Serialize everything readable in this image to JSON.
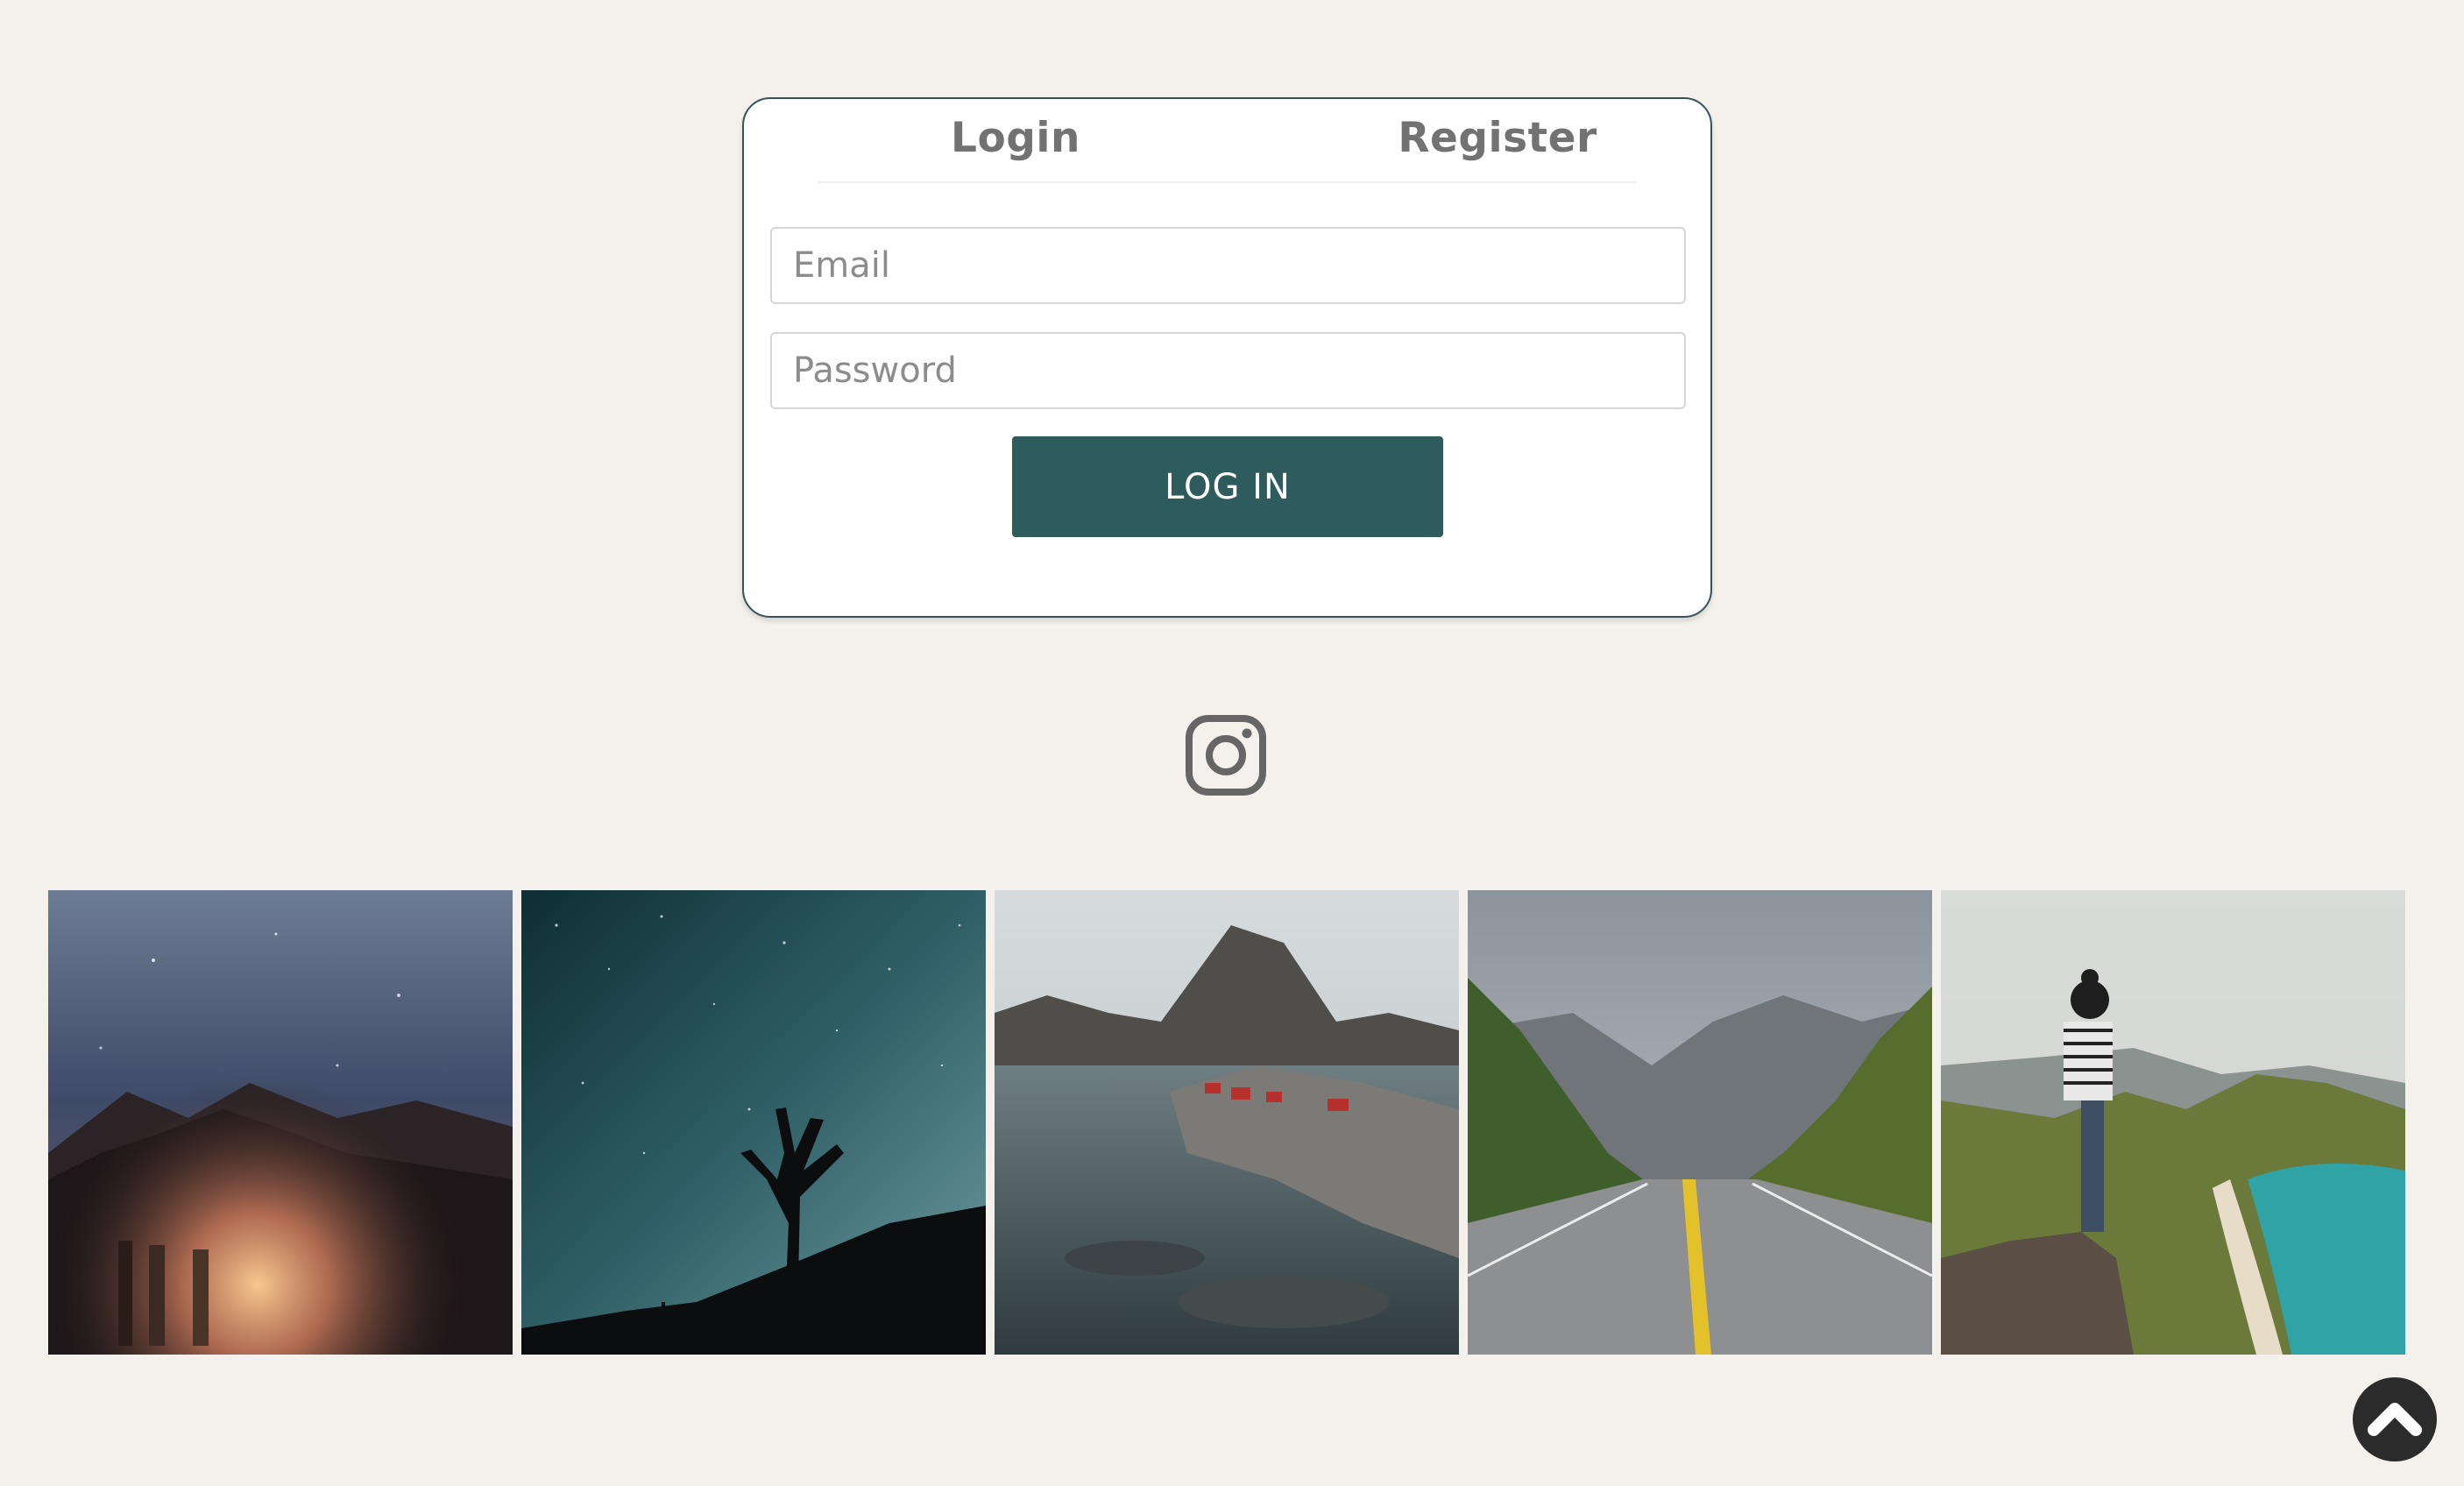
{
  "auth": {
    "tabs": [
      {
        "label": "Login"
      },
      {
        "label": "Register"
      }
    ],
    "email": {
      "placeholder": "Email",
      "value": ""
    },
    "password": {
      "placeholder": "Password",
      "value": ""
    },
    "submit_label": "LOG IN"
  },
  "social": {
    "icon": "instagram-icon"
  },
  "gallery": {
    "photos": [
      {
        "subject": "campfire-under-milky-way"
      },
      {
        "subject": "joshua-tree-starry-sky"
      },
      {
        "subject": "coastal-village-mountain"
      },
      {
        "subject": "road-through-forest"
      },
      {
        "subject": "hiker-overlooking-beach"
      }
    ]
  },
  "scroll_top": {
    "icon": "chevron-up-icon"
  },
  "colors": {
    "background": "#f4f0eb",
    "accent": "#2e5b5b",
    "card_border": "#35535a",
    "tab_text": "#727272"
  }
}
